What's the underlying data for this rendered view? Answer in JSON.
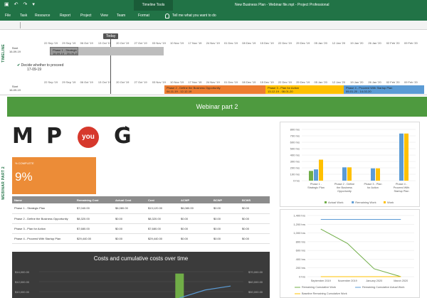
{
  "titlebar": {
    "tools_label": "Timeline Tools",
    "doc_title": "New Business Plan - Webinar file.mpt  -  Project Professional"
  },
  "ribbon": {
    "tabs": [
      "File",
      "Task",
      "Resource",
      "Report",
      "Project",
      "View",
      "Team",
      "Format"
    ],
    "tell_me": "Tell me what you want to do"
  },
  "timeline": {
    "side_label": "TIMELINE",
    "today_label": "Today",
    "scale_dates": [
      "22 Sep '19",
      "29 Sep '19",
      "06 Oct '19",
      "13 Oct '19",
      "20 Oct '19",
      "27 Oct '19",
      "03 Nov '19",
      "10 Nov '19",
      "17 Nov '19",
      "24 Nov '19",
      "01 Dec '19",
      "08 Dec '19",
      "15 Dec '19",
      "22 Dec '19",
      "29 Dec '19",
      "05 Jan '20",
      "12 Jan '20",
      "19 Jan '20",
      "26 Jan '20",
      "02 Feb '20",
      "09 Feb '20"
    ],
    "row1": {
      "start": "Start\n16-09-19",
      "bars": [
        {
          "label": "Phase 1 - Strategic Plan\n16-09-19 - 20-09-19",
          "color": "#9a9a9a"
        },
        {
          "label": "",
          "color": "#bdbdbd"
        }
      ]
    },
    "milestone": {
      "label": "Decide whether to proceed",
      "date": "17-09-19"
    },
    "row2": {
      "start": "Start\n16-09-19",
      "bars": [
        {
          "label": "Phase 2 - Define the Business Opportunity\n04-11-19 - 12-12-19",
          "color": "#ed7d31"
        },
        {
          "label": "Phase 3 - Plan for Action\n13-12-19 - 08-01-20",
          "color": "#ffc000"
        },
        {
          "label": "Phase 4 - Proceed With Startup Plan\n09-01-20 - 14-02-20",
          "color": "#5b9bd5"
        }
      ]
    }
  },
  "report": {
    "side_label": "WEBINAR PART 2",
    "title": "Webinar part 2",
    "logos": {
      "m": "M",
      "p": "P",
      "you": "you",
      "g": "G"
    },
    "kpi": {
      "label": "% COMPLETE",
      "value": "9%"
    },
    "table": {
      "headers": [
        "Name",
        "Remaining Cost",
        "Actual Cost",
        "Cost",
        "ACWP",
        "BCWP",
        "BCWS"
      ],
      "rows": [
        [
          "Phase 1 - Strategic Plan",
          "$7,040.00",
          "$6,080.00",
          "$13,120.00",
          "$6,080.00",
          "$0.00",
          "$0.00"
        ],
        [
          "Phase 2 - Define the Business Opportunity",
          "$8,320.00",
          "$0.00",
          "$8,320.00",
          "$0.00",
          "$0.00",
          "$0.00"
        ],
        [
          "Phase 3 - Plan for Action",
          "$7,680.00",
          "$0.00",
          "$7,680.00",
          "$0.00",
          "$0.00",
          "$0.00"
        ],
        [
          "Phase 4 - Proceed With Startup Plan",
          "$29,440.00",
          "$0.00",
          "$29,440.00",
          "$0.00",
          "$0.00",
          "$0.00"
        ]
      ]
    },
    "costs_chart": {
      "title": "Costs and cumulative costs over time",
      "left_ticks": [
        "$14,000.00",
        "$12,000.00",
        "$10,000.00"
      ],
      "right_ticks": [
        "$70,000.00",
        "$60,000.00",
        "$50,000.00"
      ]
    }
  },
  "chart_data": [
    {
      "type": "bar",
      "title": "",
      "categories": [
        "Phase 1 - Strategic Plan",
        "Phase 2 - Define the Business Opportunity",
        "Phase 3 - Plan for Action",
        "Phase 4 - Proceed With Startup Plan"
      ],
      "series": [
        {
          "name": "Actual Work",
          "color": "#70ad47",
          "values": [
            152,
            0,
            0,
            0
          ]
        },
        {
          "name": "Remaining Work",
          "color": "#5b9bd5",
          "values": [
            176,
            208,
            192,
            736
          ]
        },
        {
          "name": "Work",
          "color": "#ffc000",
          "values": [
            328,
            208,
            192,
            736
          ]
        }
      ],
      "y_ticks": [
        "0 hrs",
        "100 hrs",
        "200 hrs",
        "300 hrs",
        "400 hrs",
        "500 hrs",
        "600 hrs",
        "700 hrs",
        "800 hrs"
      ],
      "ylim": [
        0,
        800
      ],
      "legend_position": "bottom"
    },
    {
      "type": "line",
      "title": "",
      "categories": [
        "September 2019",
        "November 2019",
        "January 2020",
        "March 2020"
      ],
      "series": [
        {
          "name": "Remaining Cumulative Work",
          "color": "#70ad47",
          "values": [
            1090,
            760,
            180,
            0
          ]
        },
        {
          "name": "Remaining Cumulative Actual Work",
          "color": "#5b9bd5",
          "values": [
            1310,
            1310,
            1310,
            1310
          ]
        },
        {
          "name": "Baseline Remaining Cumulative Work",
          "color": "#ffc000",
          "values": [
            0,
            0,
            0,
            0
          ]
        }
      ],
      "y_ticks": [
        "0 hrs",
        "200 hrs",
        "400 hrs",
        "600 hrs",
        "800 hrs",
        "1,000 hrs",
        "1,200 hrs",
        "1,400 hrs"
      ],
      "ylim": [
        0,
        1400
      ],
      "legend_position": "bottom"
    },
    {
      "type": "bar",
      "title": "Costs and cumulative costs over time",
      "series": [
        {
          "name": "Cost",
          "color": "#70ad47",
          "values": [
            0,
            0,
            0,
            0,
            0,
            13500,
            0,
            9000
          ]
        },
        {
          "name": "Cumulative Cost",
          "color": "#5b9bd5",
          "values": [
            null,
            null,
            null,
            null,
            null,
            49000,
            55000,
            58000
          ]
        }
      ],
      "y_ticks": [
        "$10,000.00",
        "$12,000.00",
        "$14,000.00"
      ],
      "y2_ticks": [
        "$50,000.00",
        "$60,000.00",
        "$70,000.00"
      ]
    }
  ]
}
